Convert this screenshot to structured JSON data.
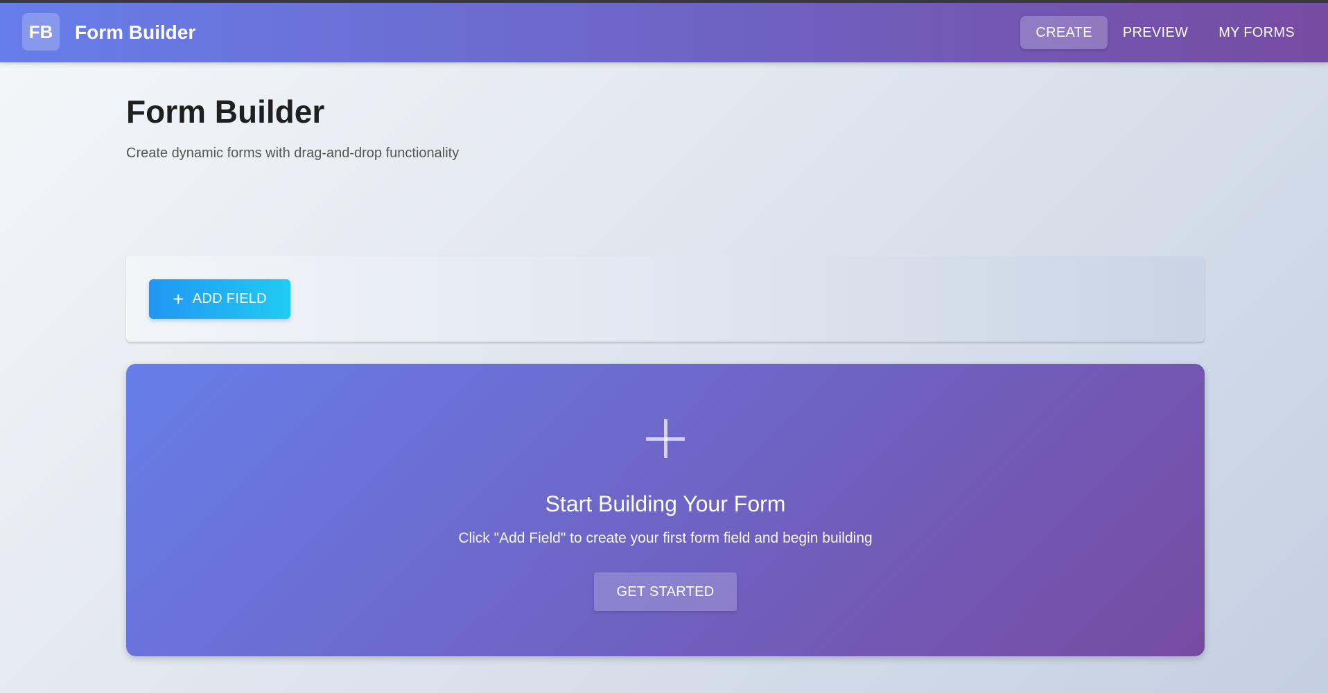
{
  "header": {
    "logo_text": "FB",
    "app_title": "Form Builder",
    "nav": [
      {
        "label": "CREATE",
        "active": true
      },
      {
        "label": "PREVIEW",
        "active": false
      },
      {
        "label": "MY FORMS",
        "active": false
      }
    ]
  },
  "page": {
    "title": "Form Builder",
    "subtitle": "Create dynamic forms with drag-and-drop functionality"
  },
  "toolbar": {
    "add_field_label": "ADD FIELD",
    "add_field_icon": "plus-icon"
  },
  "empty_state": {
    "icon": "plus-icon",
    "title": "Start Building Your Form",
    "description": "Click \"Add Field\" to create your first form field and begin building",
    "cta_label": "GET STARTED"
  },
  "colors": {
    "header_gradient_start": "#667eea",
    "header_gradient_end": "#764ba2",
    "primary_button_start": "#2196f3",
    "primary_button_end": "#21cbf3"
  }
}
